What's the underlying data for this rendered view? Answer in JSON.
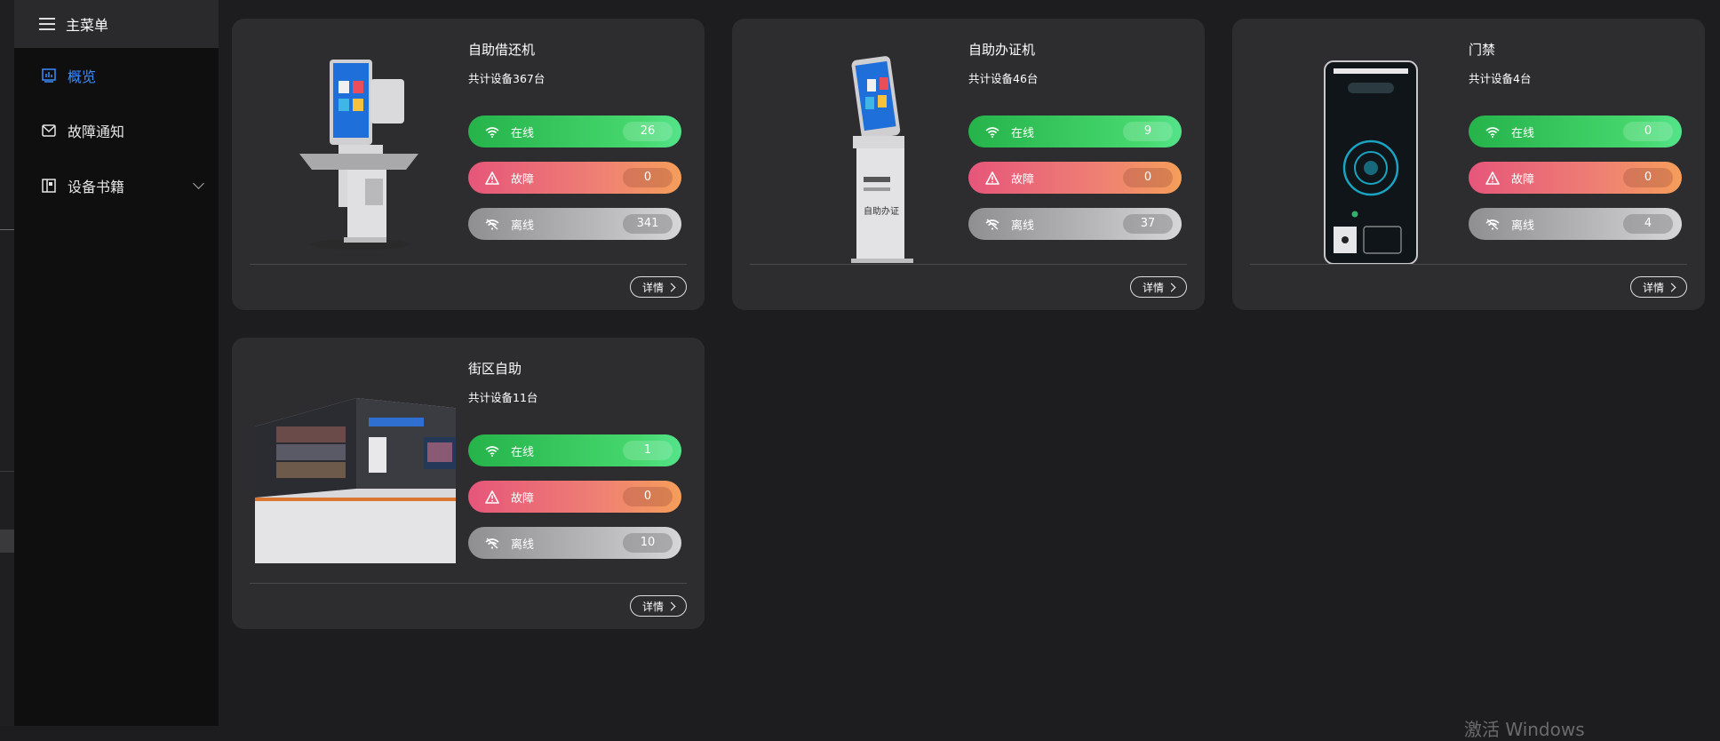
{
  "sidebar": {
    "header_label": "主菜单",
    "items": [
      {
        "label": "概览",
        "icon": "chart-icon",
        "active": true
      },
      {
        "label": "故障通知",
        "icon": "mail-icon"
      },
      {
        "label": "设备书籍",
        "icon": "book-icon",
        "expandable": true
      }
    ]
  },
  "cards": [
    {
      "title": "自助借还机",
      "total": "共计设备367台",
      "online_label": "在线",
      "online": "26",
      "fault_label": "故障",
      "fault": "0",
      "offline_label": "离线",
      "offline": "341",
      "detail_label": "详情"
    },
    {
      "title": "自助办证机",
      "total": "共计设备46台",
      "online_label": "在线",
      "online": "9",
      "fault_label": "故障",
      "fault": "0",
      "offline_label": "离线",
      "offline": "37",
      "detail_label": "详情"
    },
    {
      "title": "门禁",
      "total": "共计设备4台",
      "online_label": "在线",
      "online": "0",
      "fault_label": "故障",
      "fault": "0",
      "offline_label": "离线",
      "offline": "4",
      "detail_label": "详情"
    },
    {
      "title": "街区自助",
      "total": "共计设备11台",
      "online_label": "在线",
      "online": "1",
      "fault_label": "故障",
      "fault": "0",
      "offline_label": "离线",
      "offline": "10",
      "detail_label": "详情"
    }
  ],
  "colors": {
    "active": "#3d8bff",
    "online": "#35c75a",
    "fault": "#ec6c78",
    "offline": "#b0b0b3"
  },
  "watermark": "激活 Windows"
}
